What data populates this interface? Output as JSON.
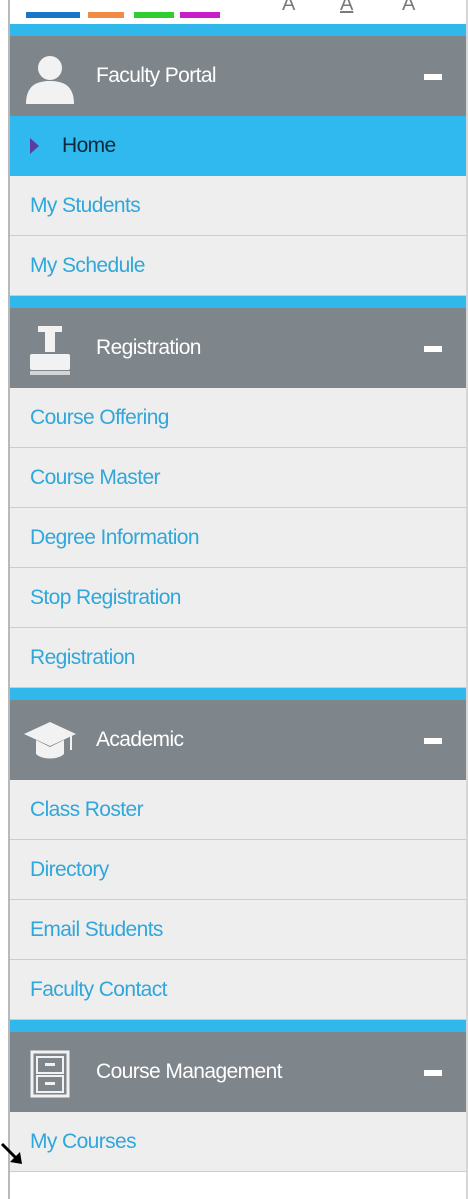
{
  "colors": {
    "accent": "#30b8ea",
    "header_bg": "#7e858b",
    "item_bg": "#eeeeee",
    "link": "#30a7db",
    "active_bg": "#2fb9ee",
    "swatches": [
      "#1a74c8",
      "#f08a44",
      "#2fce2f",
      "#c81ec8"
    ]
  },
  "font_size_controls": [
    "A",
    "A",
    "A"
  ],
  "sections": [
    {
      "title": "Faculty Portal",
      "icon": "user-silhouette-icon",
      "items": [
        {
          "label": "Home",
          "active": true
        },
        {
          "label": "My Students"
        },
        {
          "label": "My Schedule"
        }
      ]
    },
    {
      "title": "Registration",
      "icon": "stamp-icon",
      "items": [
        {
          "label": "Course Offering"
        },
        {
          "label": "Course Master"
        },
        {
          "label": "Degree Information"
        },
        {
          "label": "Stop Registration"
        },
        {
          "label": "Registration"
        }
      ]
    },
    {
      "title": "Academic",
      "icon": "graduation-cap-icon",
      "items": [
        {
          "label": "Class Roster"
        },
        {
          "label": "Directory"
        },
        {
          "label": "Email Students"
        },
        {
          "label": "Faculty Contact"
        }
      ]
    },
    {
      "title": "Course Management",
      "icon": "file-cabinet-icon",
      "items": [
        {
          "label": "My Courses"
        }
      ]
    }
  ]
}
